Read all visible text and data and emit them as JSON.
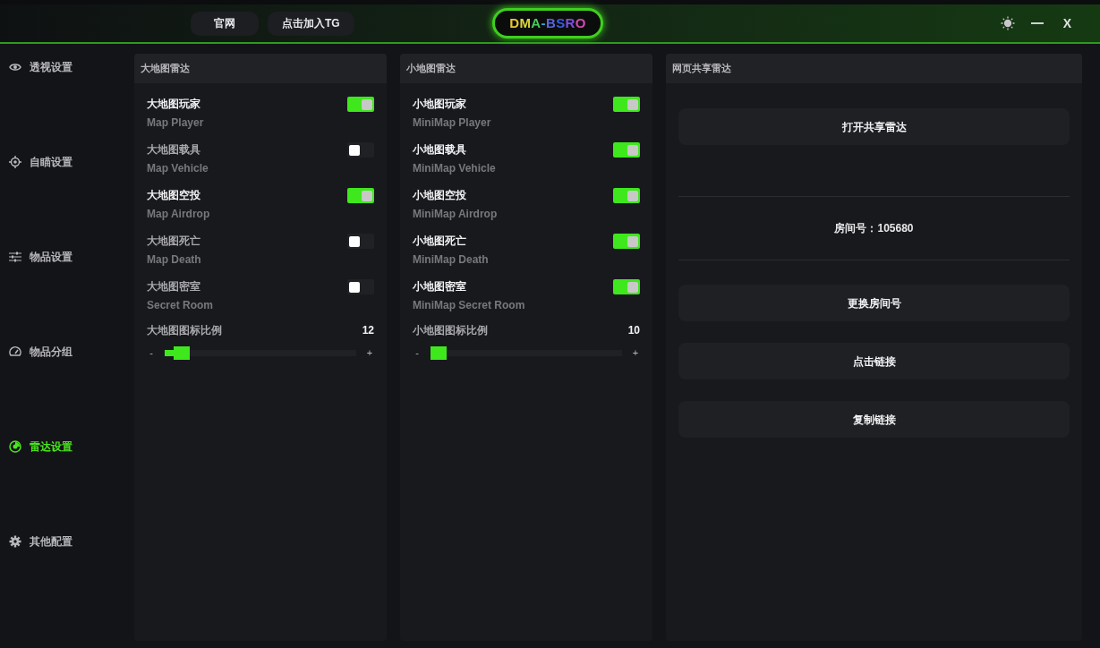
{
  "header": {
    "links": [
      "官网",
      "点击加入TG"
    ],
    "logo": "DMA-BSRO",
    "window_controls": {
      "close": "X"
    }
  },
  "sidebar": {
    "items": [
      {
        "label": "透视设置",
        "selected": false
      },
      {
        "label": "自瞄设置",
        "selected": false
      },
      {
        "label": "物品设置",
        "selected": false
      },
      {
        "label": "物品分组",
        "selected": false
      },
      {
        "label": "雷达设置",
        "selected": true
      },
      {
        "label": "其他配置",
        "selected": false
      }
    ]
  },
  "panels": [
    {
      "title": "大地图雷达",
      "toggles": [
        {
          "label": "大地图玩家",
          "sublabel": "Map Player",
          "on": true
        },
        {
          "label": "大地图载具",
          "sublabel": "Map Vehicle",
          "on": false
        },
        {
          "label": "大地图空投",
          "sublabel": "Map Airdrop",
          "on": true
        },
        {
          "label": "大地图死亡",
          "sublabel": "Map Death",
          "on": false
        },
        {
          "label": "大地图密室",
          "sublabel": "Secret Room",
          "on": false
        }
      ],
      "slider": {
        "label": "大地图图标比例",
        "reading": "12",
        "minus": "-",
        "plus": "+",
        "level": 0.05
      }
    },
    {
      "title": "小地图雷达",
      "toggles": [
        {
          "label": "小地图玩家",
          "sublabel": "MiniMap Player",
          "on": true
        },
        {
          "label": "小地图载具",
          "sublabel": "MiniMap Vehicle",
          "on": true
        },
        {
          "label": "小地图空投",
          "sublabel": "MiniMap Airdrop",
          "on": true
        },
        {
          "label": "小地图死亡",
          "sublabel": "MiniMap Death",
          "on": true
        },
        {
          "label": "小地图密室",
          "sublabel": "MiniMap Secret Room",
          "on": true
        }
      ],
      "slider": {
        "label": "小地图图标比例",
        "reading": "10",
        "minus": "-",
        "plus": "+",
        "level": 0
      }
    }
  ],
  "share_panel": {
    "title": "网页共享雷达",
    "open_button": "打开共享雷达",
    "room": "房间号：105680",
    "buttons": [
      "更换房间号",
      "点击链接",
      "复制链接"
    ]
  }
}
